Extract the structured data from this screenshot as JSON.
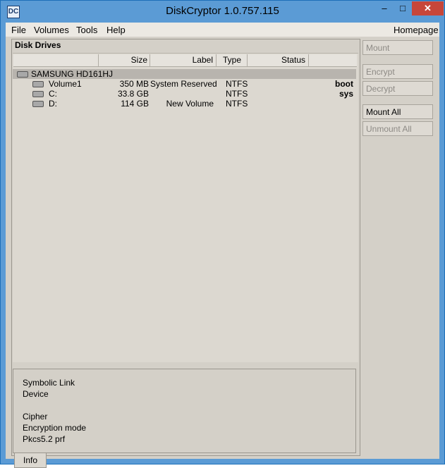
{
  "window": {
    "title": "DiskCryptor 1.0.757.115",
    "icon_glyph": "DC"
  },
  "controls": {
    "minimize": "–",
    "maximize": "□",
    "close": "✕"
  },
  "menu": {
    "file": "File",
    "volumes": "Volumes",
    "tools": "Tools",
    "help": "Help",
    "homepage": "Homepage"
  },
  "drives": {
    "title": "Disk Drives",
    "columns": [
      "Size",
      "Label",
      "Type",
      "Status"
    ],
    "disk": {
      "name": "SAMSUNG HD161HJ"
    },
    "volumes": [
      {
        "name": "Volume1",
        "size": "350 MB",
        "label": "System Reserved",
        "type": "NTFS",
        "flag": "boot"
      },
      {
        "name": "C:",
        "size": "33.8 GB",
        "label": "",
        "type": "NTFS",
        "flag": "sys"
      },
      {
        "name": "D:",
        "size": "114 GB",
        "label": "New Volume",
        "type": "NTFS",
        "flag": ""
      }
    ]
  },
  "info": {
    "symbolic_link": "Symbolic Link",
    "device": "Device",
    "cipher": "Cipher",
    "encryption_mode": "Encryption mode",
    "prf": "Pkcs5.2 prf",
    "tab": "Info"
  },
  "actions": {
    "mount": "Mount",
    "encrypt": "Encrypt",
    "decrypt": "Decrypt",
    "mount_all": "Mount All",
    "unmount_all": "Unmount All"
  }
}
